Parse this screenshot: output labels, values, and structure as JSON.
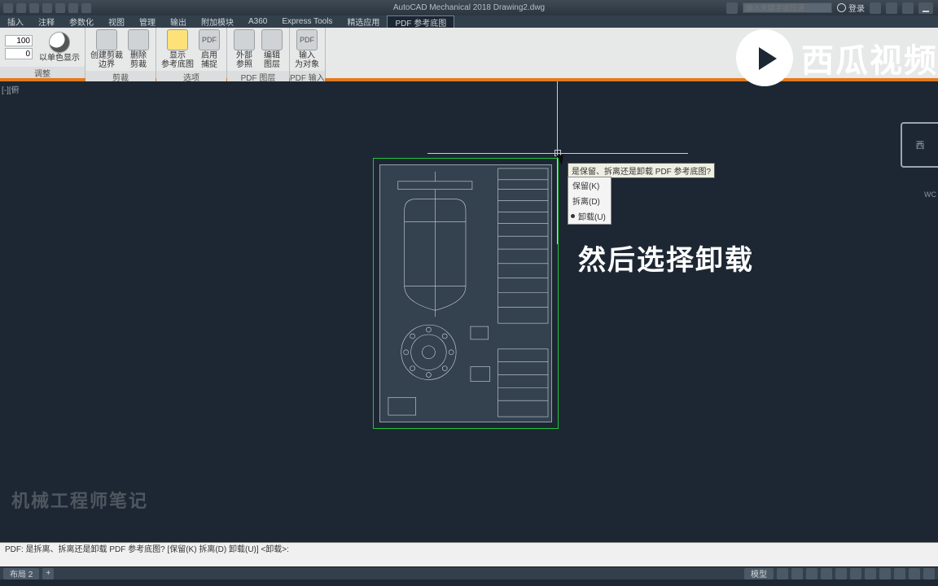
{
  "app": {
    "title_full": "AutoCAD Mechanical 2018    Drawing2.dwg"
  },
  "titlebar": {
    "search_ph": "输入关键字或短语",
    "user_label": "登录"
  },
  "menu": {
    "items": [
      "插入",
      "注释",
      "参数化",
      "视图",
      "管理",
      "输出",
      "附加模块",
      "A360",
      "Express Tools",
      "精选应用",
      "PDF 参考底图"
    ],
    "selected_index": 10
  },
  "ribbon": {
    "fade_top": "100",
    "fade_bottom": "0",
    "g_adjust": "调整",
    "btn_mono": "以单色显示",
    "btn_create": "创建剪裁\n边界",
    "btn_delclip": "删除\n剪裁",
    "g_clip": "剪裁",
    "btn_show": "显示\n参考底图",
    "btn_snap": "启用\n捕捉",
    "g_opt": "选项",
    "btn_xref": "外部\n参照",
    "btn_editlayer": "编辑\n图层",
    "g_pdflayer": "PDF 图层",
    "btn_import": "输入\n为对象",
    "g_pdfimport": "PDF 输入"
  },
  "canvas": {
    "side_tag": "[-][俯",
    "tooltip": "是保留、拆离还是卸载 PDF 参考底图?",
    "menu_keep": "保留(K)",
    "menu_detach": "拆离(D)",
    "menu_unload": "卸载(U)",
    "annotation": "然后选择卸载",
    "viewcube": "西",
    "wcs": "WC"
  },
  "cmd": {
    "line1": "PDF: 是拆离、拆离还是卸载 PDF 参考底图? [保留(K)  拆离(D)  卸载(U)]  <卸载>:",
    "line0": ""
  },
  "status": {
    "tab1": "布局 2",
    "model": "模型"
  },
  "bm_watermark": "机械工程师笔记"
}
